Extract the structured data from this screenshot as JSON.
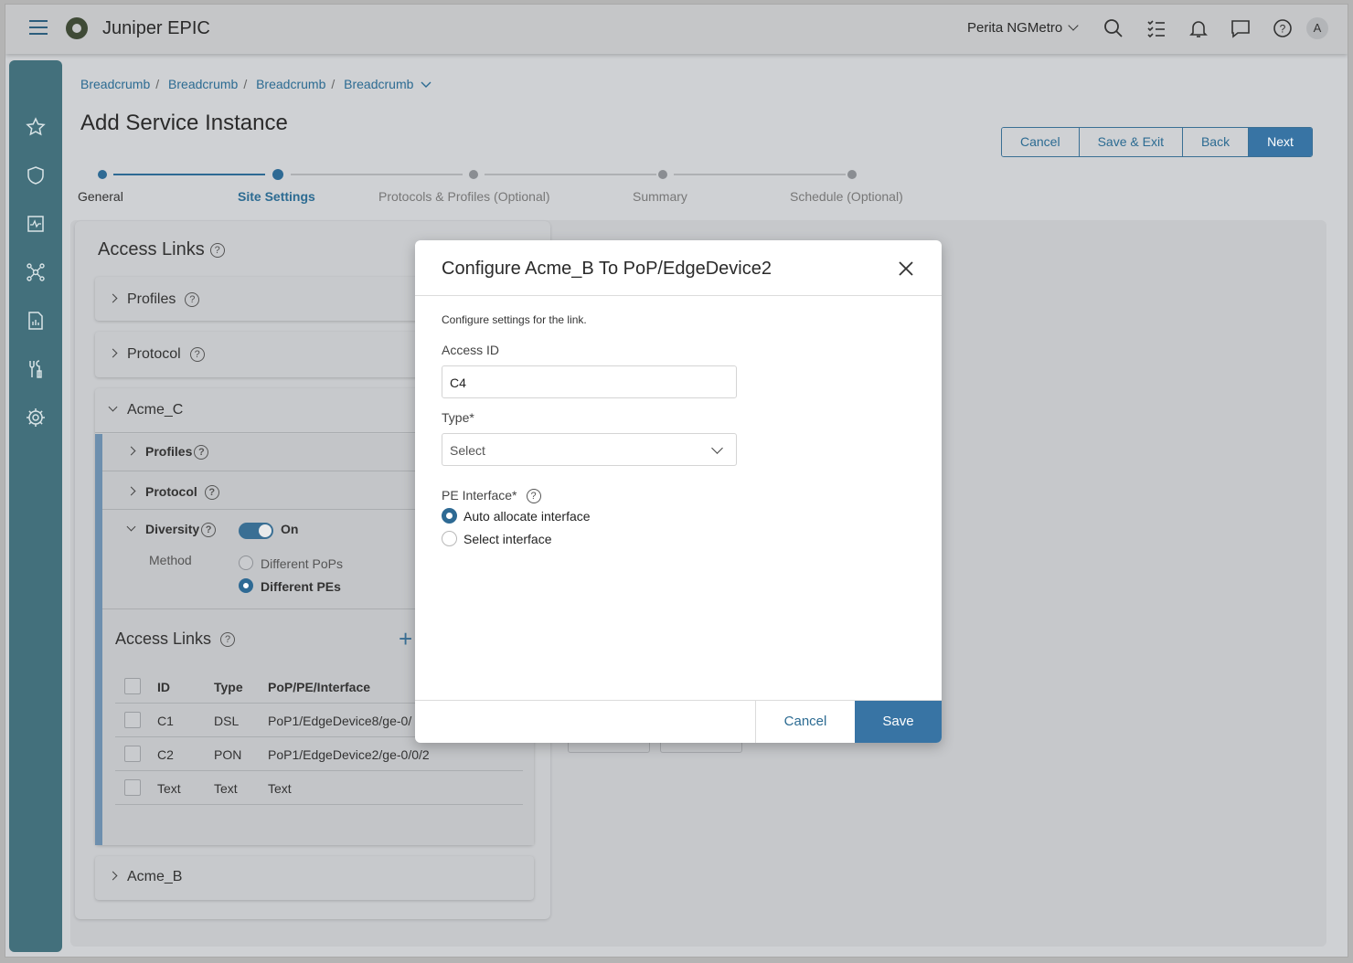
{
  "header": {
    "app_title": "Juniper EPIC",
    "org_name": "Perita NGMetro",
    "avatar_initial": "A"
  },
  "breadcrumbs": [
    "Breadcrumb",
    "Breadcrumb",
    "Breadcrumb",
    "Breadcrumb"
  ],
  "page": {
    "title": "Add Service Instance",
    "buttons": {
      "cancel": "Cancel",
      "save_exit": "Save & Exit",
      "back": "Back",
      "next": "Next"
    }
  },
  "stepper": {
    "steps": [
      "General",
      "Site Settings",
      "Protocols & Profiles (Optional)",
      "Summary",
      "Schedule (Optional)"
    ],
    "active_index": 1
  },
  "left_panel": {
    "heading": "Access Links",
    "sections": {
      "profiles": "Profiles",
      "protocol": "Protocol"
    },
    "acme_c": {
      "name": "Acme_C",
      "profiles": "Profiles",
      "protocol": "Protocol",
      "diversity": "Diversity",
      "diversity_state": "On",
      "method_label": "Method",
      "methods": [
        "Different PoPs",
        "Different PEs"
      ],
      "selected_method": "Different PEs",
      "access_links_heading": "Access Links",
      "table": {
        "columns": [
          "ID",
          "Type",
          "PoP/PE/Interface"
        ],
        "rows": [
          {
            "id": "C1",
            "type": "DSL",
            "interface": "PoP1/EdgeDevice8/ge-0/"
          },
          {
            "id": "C2",
            "type": "PON",
            "interface": "PoP1/EdgeDevice2/ge-0/0/2"
          },
          {
            "id": "Text",
            "type": "Text",
            "interface": "Text"
          }
        ]
      }
    },
    "acme_b": {
      "name": "Acme_B"
    }
  },
  "modal": {
    "title": "Configure Acme_B To PoP/EdgeDevice2",
    "description": "Configure settings for the link.",
    "access_id_label": "Access ID",
    "access_id_value": "C4",
    "type_label": "Type*",
    "type_value": "Select",
    "pe_interface_label": "PE Interface*",
    "pe_options": [
      "Auto allocate interface",
      "Select interface"
    ],
    "pe_selected": "Auto allocate interface",
    "cancel_label": "Cancel",
    "save_label": "Save"
  },
  "colors": {
    "accent": "#3874a4",
    "sidebar": "#43707c",
    "link": "#2c6b92"
  },
  "icons": [
    "menu-icon",
    "brand-logo-icon",
    "chevron-down-icon",
    "search-icon",
    "checklist-icon",
    "bell-icon",
    "chat-icon",
    "help-icon",
    "star-icon",
    "shield-icon",
    "monitor-icon",
    "topology-icon",
    "report-icon",
    "tools-icon",
    "gear-icon",
    "close-icon",
    "plus-icon"
  ]
}
